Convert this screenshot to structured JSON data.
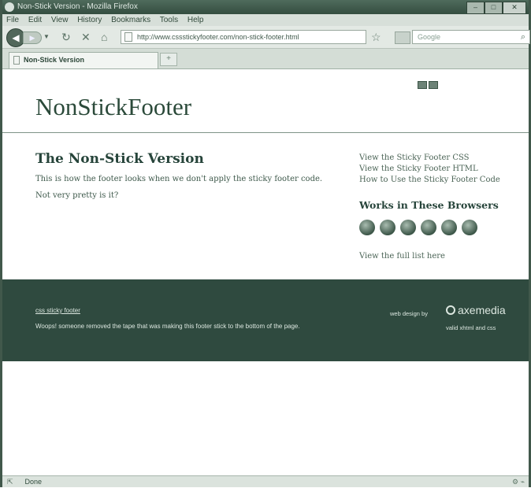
{
  "window": {
    "title": "Non-Stick Version - Mozilla Firefox",
    "controls": [
      "–",
      "□",
      "✕"
    ]
  },
  "menu": [
    "File",
    "Edit",
    "View",
    "History",
    "Bookmarks",
    "Tools",
    "Help"
  ],
  "nav": {
    "back_icon": "◀",
    "forward_icon": "▶",
    "url": "http://www.cssstickyfooter.com/non-stick-footer.html",
    "search_placeholder": "Google"
  },
  "tabs": [
    {
      "label": "Non-Stick Version"
    }
  ],
  "page": {
    "logo": "NonStickFooter",
    "heading": "The Non-Stick Version",
    "paragraphs": [
      "This is how the footer looks when we don't apply the sticky footer code.",
      "Not very pretty is it?"
    ],
    "sidebar_links": [
      "View the Sticky Footer CSS",
      "View the Sticky Footer HTML",
      "How to Use the Sticky Footer Code"
    ],
    "browsers_heading": "Works in These Browsers",
    "browser_icons": [
      "firefox-icon",
      "safari-icon",
      "ie-icon",
      "opera-icon",
      "chrome-icon",
      "konqueror-icon"
    ],
    "full_list_link": "View the full list here"
  },
  "footer": {
    "link": "css sticky footer",
    "text": "Woops! someone removed the tape that was making this footer stick to the bottom of the page.",
    "webdesign": "web design by",
    "brand": "axemedia",
    "validate": "valid xhtml and css"
  },
  "status": {
    "text": "Done"
  }
}
